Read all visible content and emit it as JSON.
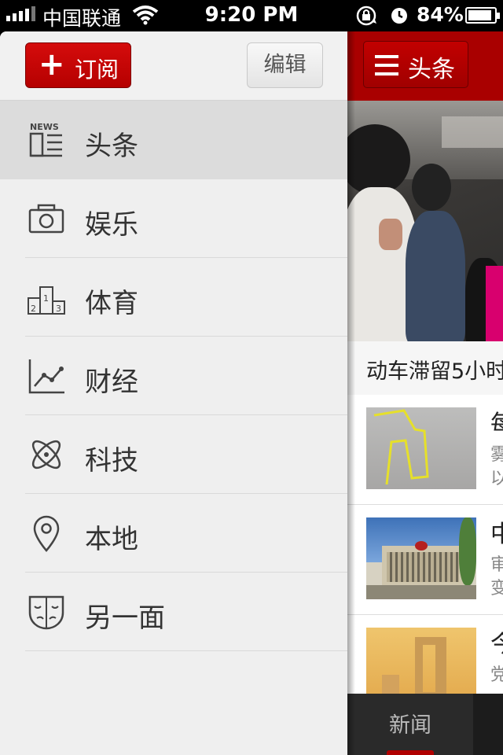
{
  "status_bar": {
    "carrier": "中国联通",
    "time": "9:20 PM",
    "battery_percent": "84%"
  },
  "menu": {
    "subscribe_label": "订阅",
    "edit_label": "编辑",
    "items": [
      {
        "label": "头条",
        "icon": "news-icon",
        "active": true
      },
      {
        "label": "娱乐",
        "icon": "camera-icon",
        "active": false
      },
      {
        "label": "体育",
        "icon": "podium-icon",
        "active": false
      },
      {
        "label": "财经",
        "icon": "chart-icon",
        "active": false
      },
      {
        "label": "科技",
        "icon": "atom-icon",
        "active": false
      },
      {
        "label": "本地",
        "icon": "location-pin-icon",
        "active": false
      },
      {
        "label": "另一面",
        "icon": "mask-icon",
        "active": false
      }
    ],
    "icon_text": {
      "news": "NEWS",
      "podium": [
        "2",
        "1",
        "3"
      ]
    }
  },
  "content": {
    "header_title": "头条",
    "hero_caption": "动车滞留5小时",
    "news": [
      {
        "title": "每",
        "summary": [
          "雾",
          "以"
        ]
      },
      {
        "title": "中",
        "summary": [
          "审",
          "变"
        ]
      },
      {
        "title": "今",
        "summary": [
          "党"
        ]
      }
    ],
    "tab_label": "新闻"
  },
  "colors": {
    "brand_red": "#b50000",
    "menu_background": "#efefef",
    "active_item": "#dcdcdc"
  }
}
